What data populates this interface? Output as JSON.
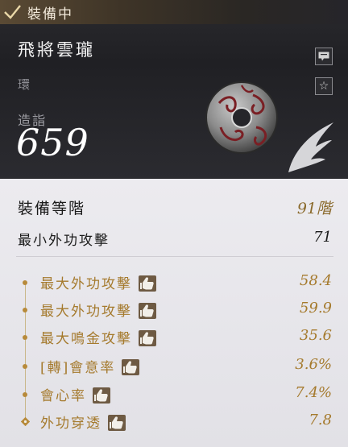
{
  "header": {
    "status_label": "裝備中",
    "item_name": "飛將雲瓏",
    "item_type": "環",
    "mastery_label": "造詣",
    "mastery_value": "659"
  },
  "icons": {
    "status": "checkmark-icon",
    "chat": "chat-icon",
    "favorite": "star-icon",
    "item": "ring-icon",
    "wing": "wing-icon",
    "thumb": "thumbs-up-icon"
  },
  "stats": {
    "grade_label": "裝備等階",
    "grade_value": "91階",
    "min_attack_label": "最小外功攻擊",
    "min_attack_value": "71"
  },
  "bonuses": [
    {
      "name": "最大外功攻擊",
      "value": "58.4"
    },
    {
      "name": "最大外功攻擊",
      "value": "59.9"
    },
    {
      "name": "最大鳴金攻擊",
      "value": "35.6"
    },
    {
      "name": "[轉]會意率",
      "value": "3.6%"
    },
    {
      "name": "會心率",
      "value": "7.4%"
    },
    {
      "name": "外功穿透",
      "value": "7.8"
    }
  ],
  "colors": {
    "accent_gold": "#a57a2d",
    "grade_gold": "#8a6a2c"
  }
}
